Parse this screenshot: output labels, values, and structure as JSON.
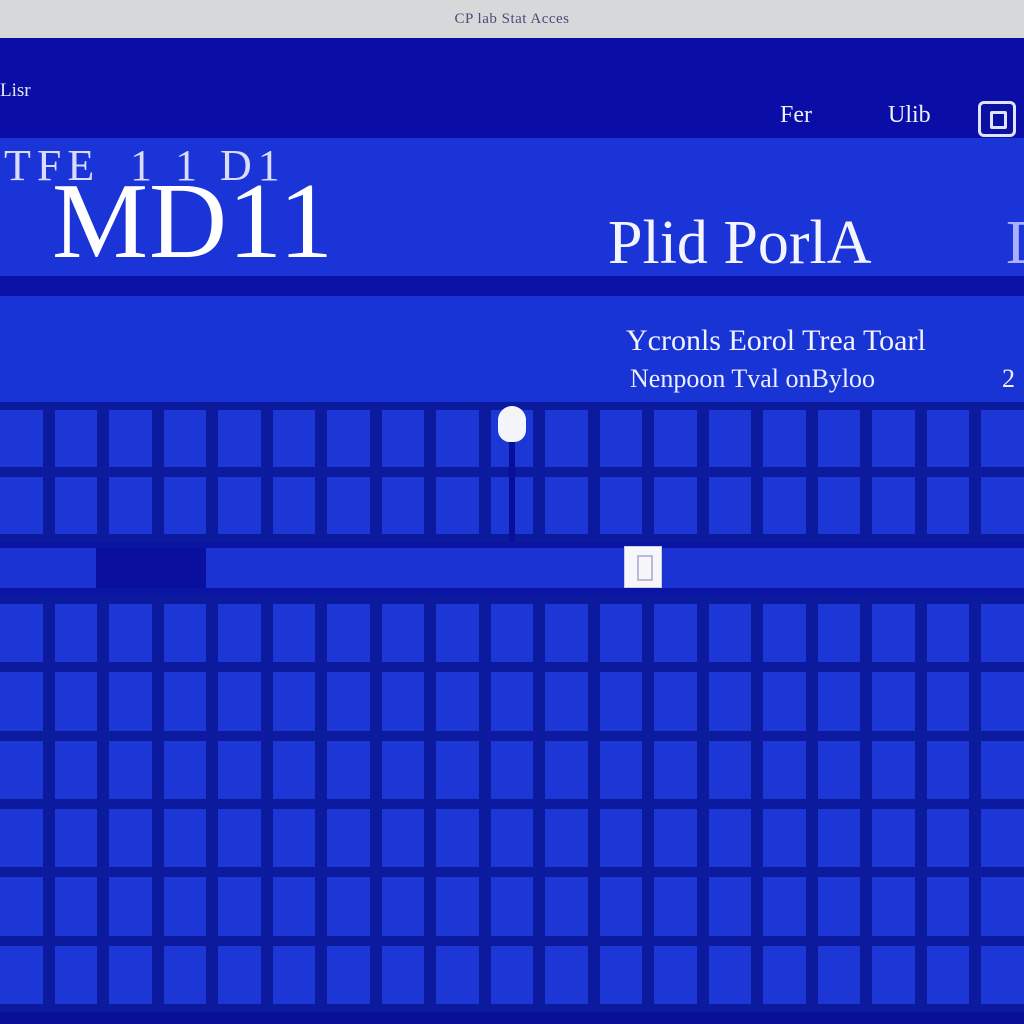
{
  "window": {
    "title": "CP lab Stat Acces"
  },
  "header": {
    "back_label": "Lisr",
    "nav_items": [
      {
        "label": "Fer"
      },
      {
        "label": "Ulib"
      }
    ]
  },
  "hero": {
    "ghost_left": "TFE",
    "ghost_right": "1  1  D1",
    "title": "MD11",
    "subtitle": "Plid PorlA",
    "subtitle_accent": "D"
  },
  "info": {
    "line1": "Ycronls Eorol Trea Toarl",
    "line2": "Nenpoon Tval onByloo",
    "number": "2"
  },
  "slider": {
    "position_fraction": 0.64
  },
  "colors": {
    "window_bg": "#0e13b4",
    "accent": "#1c37d6",
    "grid_lines": "#0c1b9e"
  }
}
